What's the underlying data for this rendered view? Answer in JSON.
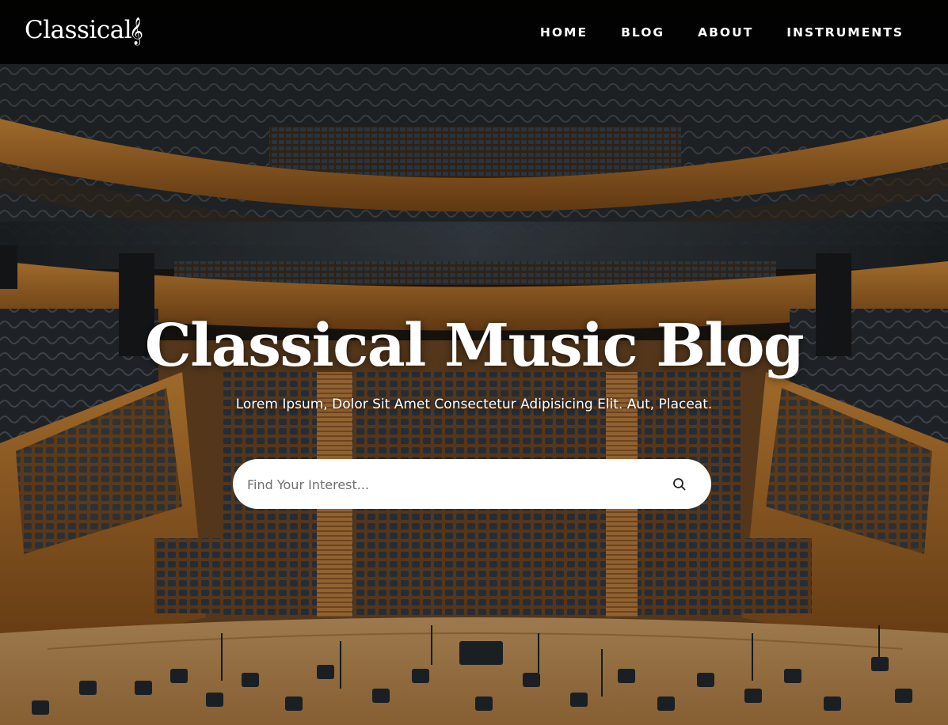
{
  "header": {
    "logo_text": "Classical",
    "logo_icon": "treble-clef-icon",
    "nav": [
      {
        "label": "HOME"
      },
      {
        "label": "BLOG"
      },
      {
        "label": "ABOUT"
      },
      {
        "label": "INSTRUMENTS"
      }
    ]
  },
  "hero": {
    "background": "concert-hall-photo",
    "title": "Classical Music Blog",
    "subtitle": "Lorem Ipsum, Dolor Sit Amet Consectetur Adipisicing Elit. Aut, Placeat.",
    "search": {
      "placeholder": "Find Your Interest...",
      "value": "",
      "icon": "search-icon"
    }
  },
  "colors": {
    "navbar_bg": "#000000",
    "text": "#ffffff",
    "wood": "#b0702c",
    "seats": "#2b3540",
    "stage": "#c99a5e"
  }
}
